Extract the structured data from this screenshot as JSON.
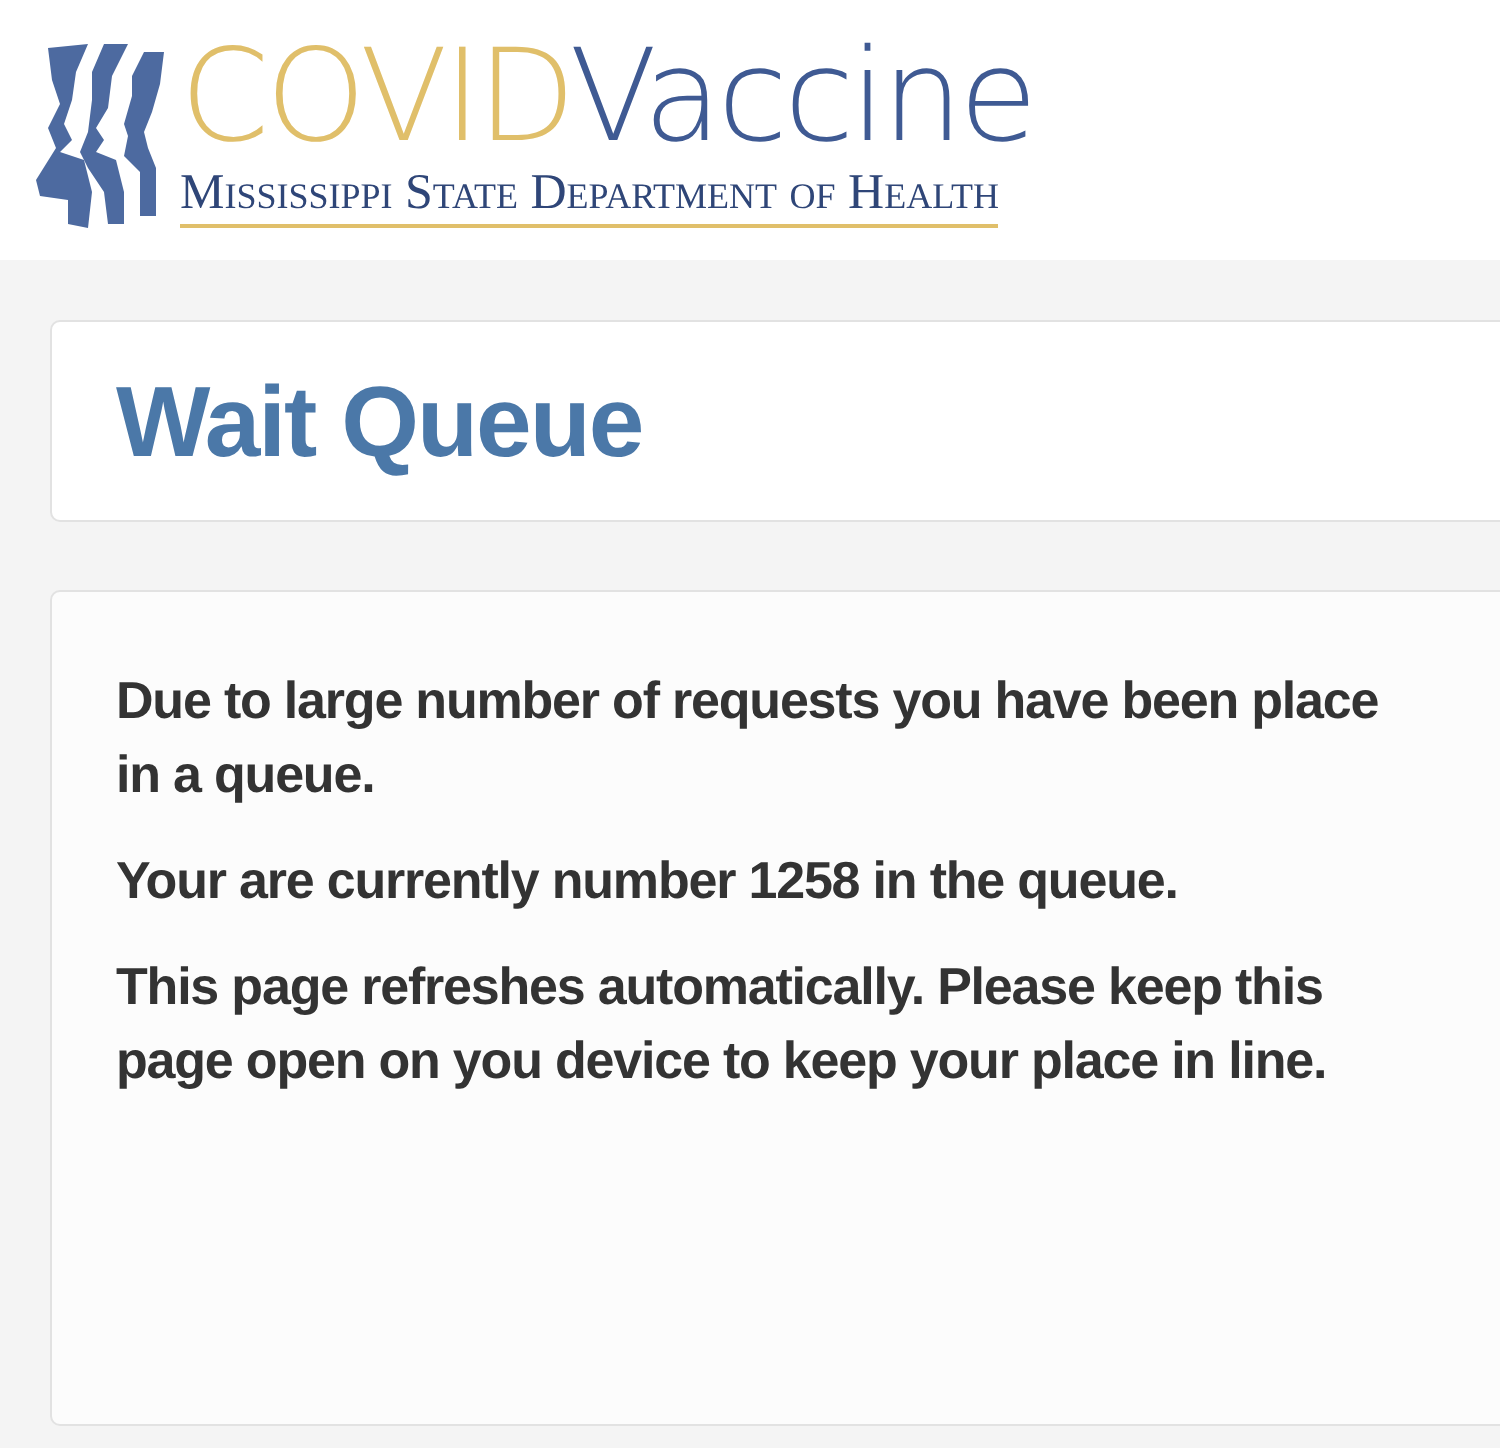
{
  "logo": {
    "title_part_1": "COVID",
    "title_part_2": "Vaccine",
    "subtitle": "Mississippi State Department of Health"
  },
  "page_title": "Wait Queue",
  "paragraphs": [
    "Due to large number of requests you have been place in a queue.",
    "Your are currently number 1258 in the queue.",
    "This page refreshes automatically. Please keep this page open on you device to keep your place in line."
  ]
}
